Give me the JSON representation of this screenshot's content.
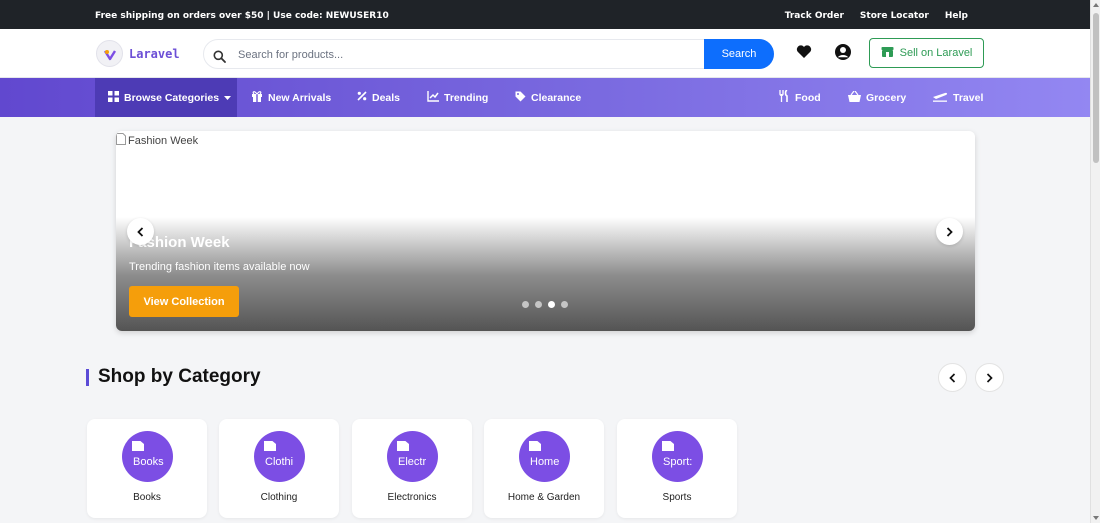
{
  "topbar": {
    "promo": "Free shipping on orders over $50 | Use code: NEWUSER10",
    "links": [
      "Track Order",
      "Store Locator",
      "Help"
    ]
  },
  "header": {
    "logo_text": "Laravel",
    "search_placeholder": "Search for products...",
    "search_button": "Search",
    "sell_button": "Sell on Laravel",
    "icons": [
      "heart-icon",
      "user-icon"
    ]
  },
  "nav": {
    "browse": "Browse Categories",
    "items": [
      "New Arrivals",
      "Deals",
      "Trending",
      "Clearance"
    ],
    "right_items": [
      "Food",
      "Grocery",
      "Travel"
    ]
  },
  "hero": {
    "image_alt": "Fashion Week",
    "title": "Fashion Week",
    "subtitle": "Trending fashion items available now",
    "cta": "View Collection",
    "slide_count": 4,
    "active_slide": 3
  },
  "categories": {
    "title": "Shop by Category",
    "items": [
      {
        "label": "Books",
        "alt": "Books"
      },
      {
        "label": "Clothing",
        "alt": "Clothi"
      },
      {
        "label": "Electronics",
        "alt": "Electr"
      },
      {
        "label": "Home & Garden",
        "alt": "Home"
      },
      {
        "label": "Sports",
        "alt": "Sport:"
      }
    ]
  },
  "colors": {
    "primary": "#0d6efd",
    "nav_gradient_start": "#6148cf",
    "nav_gradient_end": "#9387f2",
    "accent": "#f59e0b",
    "category_circle": "#7c4ee4",
    "sell_green": "#2e9b55"
  }
}
